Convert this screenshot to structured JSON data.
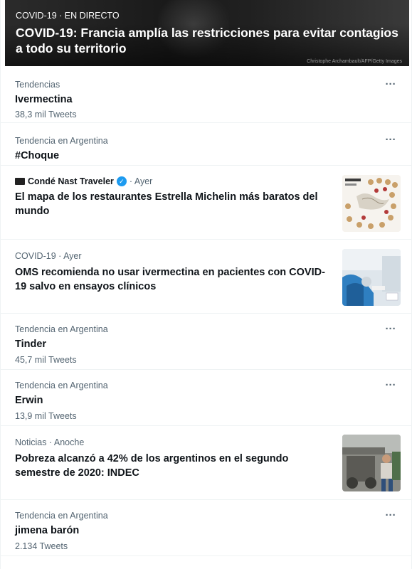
{
  "hero": {
    "meta": "COVID-19 · EN DIRECTO",
    "title": "COVID-19: Francia amplía las restricciones para evitar contagios a todo su territorio",
    "credit": "Christophe Archambault/AFP/Getty Images"
  },
  "trends": [
    {
      "meta": "Tendencias",
      "title": "Ivermectina",
      "sub": "38,3 mil Tweets"
    },
    {
      "meta": "Tendencia en Argentina",
      "title": "#Choque"
    },
    {
      "source": "Condé Nast Traveler",
      "time": "· Ayer",
      "title": "El mapa de los restaurantes Estrella Michelin más baratos del mundo"
    },
    {
      "meta": "COVID-19 · Ayer",
      "title": "OMS recomienda no usar ivermectina en pacientes con COVID-19 salvo en ensayos clínicos"
    },
    {
      "meta": "Tendencia en Argentina",
      "title": "Tinder",
      "sub": "45,7 mil Tweets"
    },
    {
      "meta": "Tendencia en Argentina",
      "title": "Erwin",
      "sub": "13,9 mil Tweets"
    },
    {
      "meta": "Noticias · Anoche",
      "title": "Pobreza alcanzó a 42% de los argentinos en el segundo semestre de 2020: INDEC"
    },
    {
      "meta": "Tendencia en Argentina",
      "title": "jimena barón",
      "sub": "2.134 Tweets"
    }
  ],
  "more_glyph": "···",
  "verified_glyph": "✓",
  "colors": {
    "accent": "#1d9bf0",
    "secondary_text": "#536471",
    "divider": "#eff3f4"
  }
}
